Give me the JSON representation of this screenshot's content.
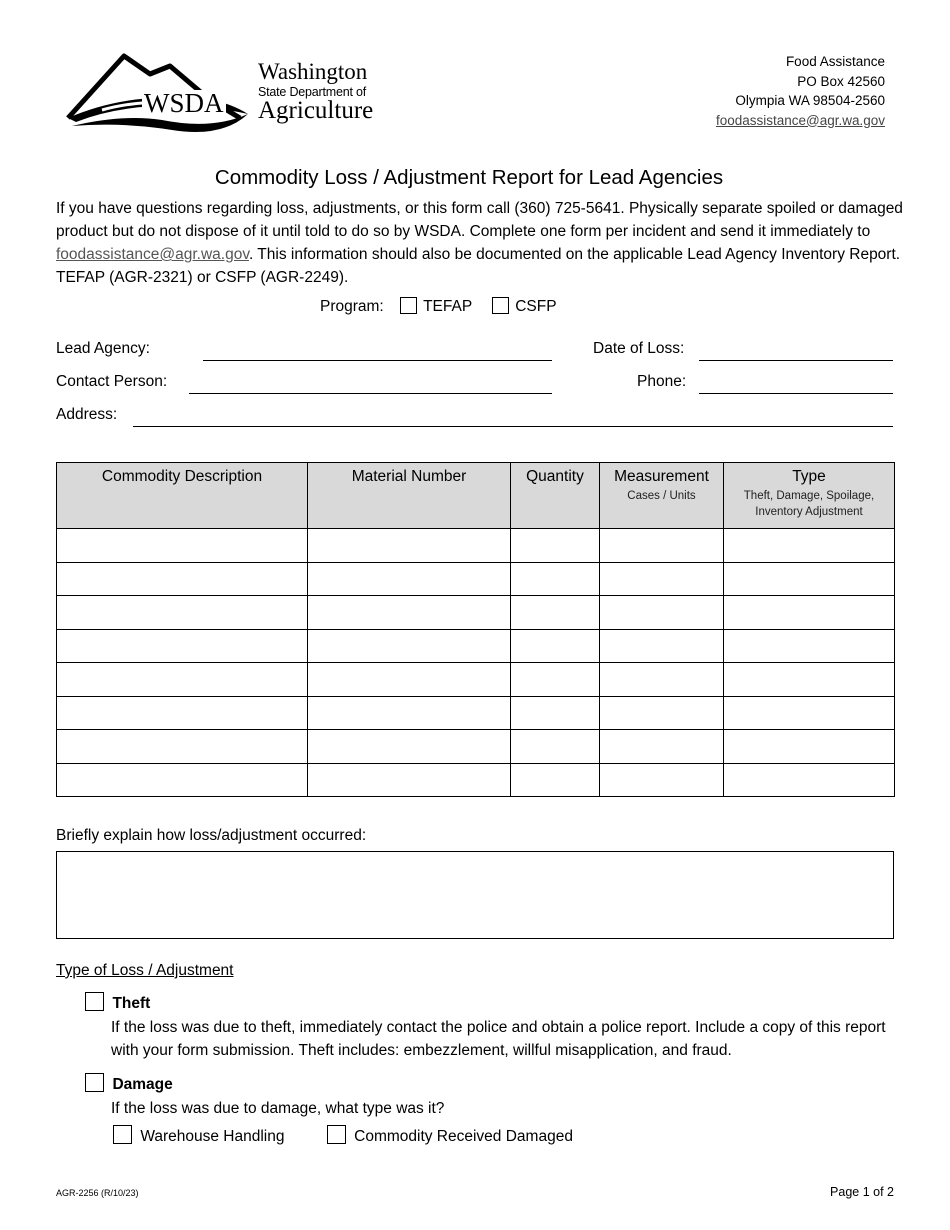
{
  "header": {
    "logo": {
      "acronym": "WSDA",
      "line1": "Washington",
      "line2": "State Department of",
      "line3": "Agriculture"
    },
    "address": {
      "dept": "Food Assistance",
      "po_box": "PO Box 42560",
      "city": "Olympia WA  98504-2560",
      "email": "foodassistance@agr.wa.gov"
    }
  },
  "title": "Commodity Loss / Adjustment Report for Lead Agencies",
  "intro": {
    "part1": "If you have questions regarding loss, adjustments, or this form call (360) 725-5641.  Physically separate spoiled or damaged product but do not dispose of it until told to do so by WSDA.  Complete one form per incident and send it immediately to ",
    "email": "foodassistance@agr.wa.gov",
    "part2": ".  This information should also be documented on the applicable Lead Agency Inventory Report. TEFAP (AGR-2321) or CSFP (AGR-2249)."
  },
  "program": {
    "label": "Program:",
    "options": [
      {
        "label": "TEFAP",
        "checked": false
      },
      {
        "label": "CSFP",
        "checked": false
      }
    ]
  },
  "fields": {
    "lead_agency": {
      "label": "Lead Agency:",
      "value": ""
    },
    "date_of_loss": {
      "label": "Date of Loss:",
      "value": ""
    },
    "contact_person": {
      "label": "Contact Person:",
      "value": ""
    },
    "phone": {
      "label": "Phone:",
      "value": ""
    },
    "address": {
      "label": "Address:",
      "value": ""
    }
  },
  "table": {
    "columns": [
      {
        "label": "Commodity Description",
        "sub": ""
      },
      {
        "label": "Material Number",
        "sub": ""
      },
      {
        "label": "Quantity",
        "sub": ""
      },
      {
        "label": "Measurement",
        "sub": "Cases / Units"
      },
      {
        "label": "Type",
        "sub": "Theft, Damage, Spoilage, Inventory Adjustment"
      }
    ],
    "rows": [
      [
        "",
        "",
        "",
        "",
        ""
      ],
      [
        "",
        "",
        "",
        "",
        ""
      ],
      [
        "",
        "",
        "",
        "",
        ""
      ],
      [
        "",
        "",
        "",
        "",
        ""
      ],
      [
        "",
        "",
        "",
        "",
        ""
      ],
      [
        "",
        "",
        "",
        "",
        ""
      ],
      [
        "",
        "",
        "",
        "",
        ""
      ],
      [
        "",
        "",
        "",
        "",
        ""
      ]
    ]
  },
  "explain": {
    "label": "Briefly explain how loss/adjustment occurred:",
    "value": ""
  },
  "type_of_loss": {
    "heading": "Type of Loss / Adjustment",
    "theft": {
      "label": "Theft",
      "checked": false,
      "description": "If the loss was due to theft, immediately contact the police and obtain a police report.  Include a copy of this report with your form submission.  Theft includes: embezzlement, willful misapplication, and fraud."
    },
    "damage": {
      "label": "Damage",
      "checked": false,
      "question": "If the loss was due to damage, what type was it?",
      "options": [
        {
          "label": "Warehouse Handling",
          "checked": false
        },
        {
          "label": "Commodity Received Damaged",
          "checked": false
        }
      ]
    }
  },
  "footer": {
    "form_id": "AGR-2256 (R/10/23)",
    "page": "Page 1 of 2"
  }
}
